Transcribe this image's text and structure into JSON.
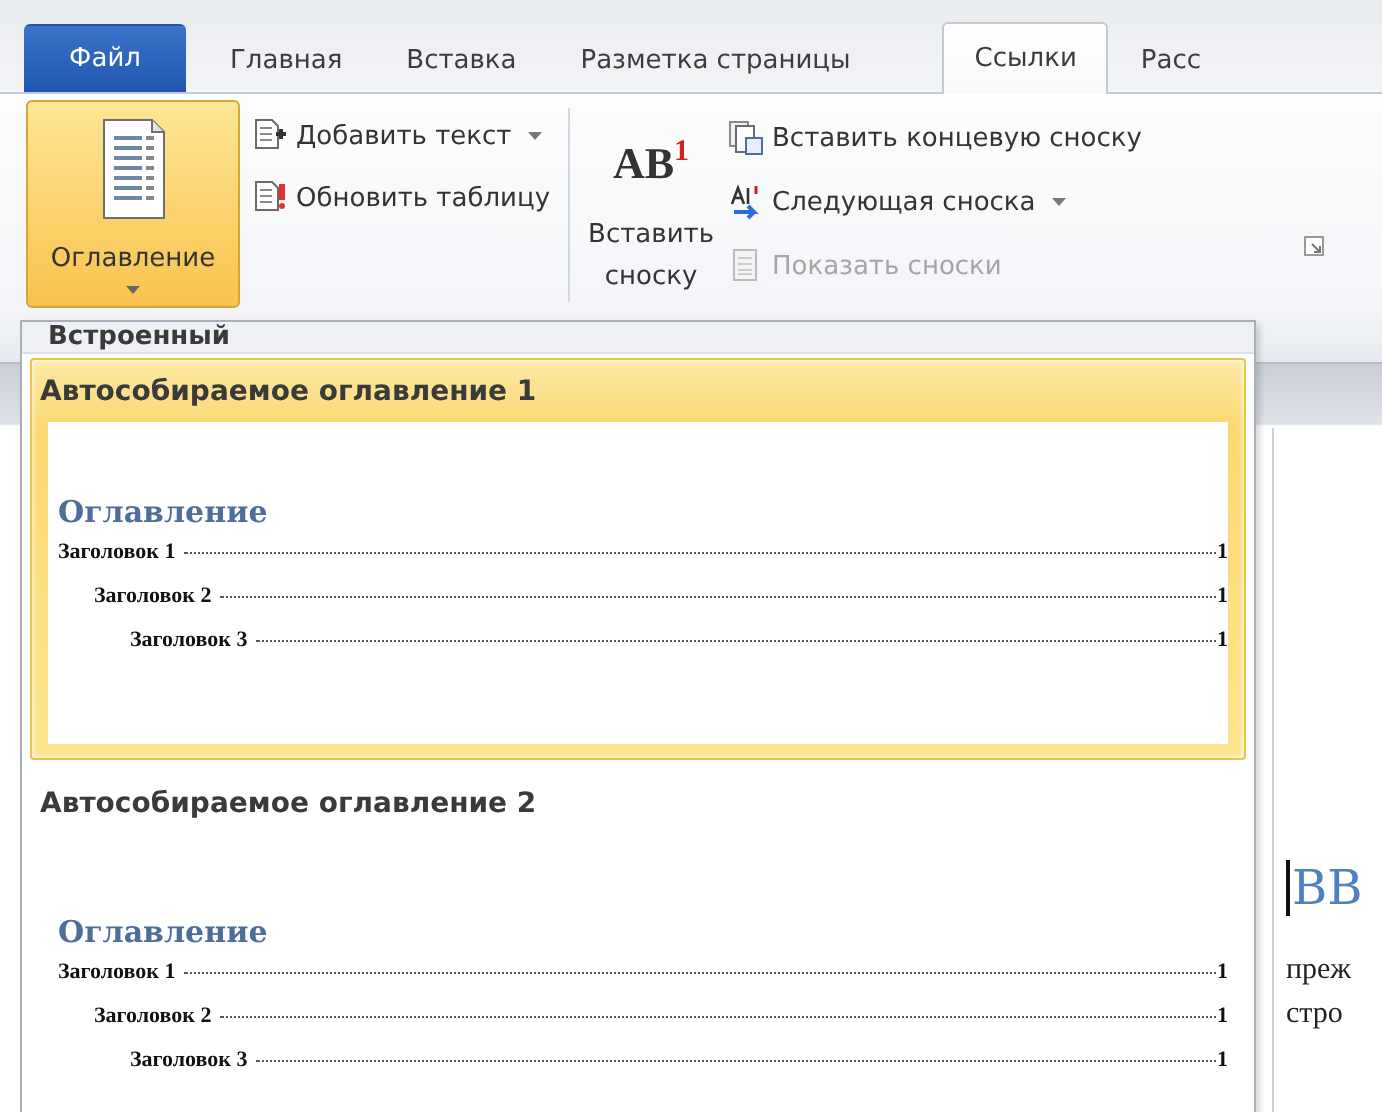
{
  "tabs": [
    {
      "label": "Файл",
      "kind": "file",
      "selected": false
    },
    {
      "label": "Главная",
      "kind": "tab",
      "selected": false
    },
    {
      "label": "Вставка",
      "kind": "tab",
      "selected": false
    },
    {
      "label": "Разметка страницы",
      "kind": "tab",
      "selected": false
    },
    {
      "label": "Ссылки",
      "kind": "tab",
      "selected": true
    },
    {
      "label": "Расс",
      "kind": "tab",
      "selected": false
    }
  ],
  "ribbon": {
    "toc_button": {
      "label": "Оглавление",
      "pressed": true
    },
    "toc_commands": [
      {
        "label": "Добавить текст",
        "kind": "add-text",
        "dropdown": true,
        "disabled": false
      },
      {
        "label": "Обновить таблицу",
        "kind": "update",
        "dropdown": false,
        "disabled": false
      }
    ],
    "footnote_button": {
      "icon_text": "AB$^{1}$",
      "label_lines": [
        "Вставить",
        "сноску"
      ]
    },
    "footnote_commands": [
      {
        "label": "Вставить концевую сноску",
        "kind": "endnote",
        "dropdown": false,
        "disabled": false
      },
      {
        "label": "Следующая сноска",
        "kind": "next",
        "dropdown": true,
        "disabled": false
      },
      {
        "label": "Показать сноски",
        "kind": "show",
        "dropdown": false,
        "disabled": true
      }
    ]
  },
  "menu": {
    "header": "Встроенный",
    "items": [
      {
        "title": "Автособираемое оглавление 1",
        "selected": true,
        "preview": {
          "heading": "Оглавление",
          "entries": [
            {
              "text": "Заголовок 1",
              "page": "1",
              "children": [
                {
                  "text": "Заголовок 2",
                  "page": "1",
                  "children": [
                    {
                      "text": "Заголовок 3",
                      "page": "1"
                    }
                  ]
                }
              ]
            }
          ]
        }
      },
      {
        "title": "Автособираемое оглавление 2",
        "selected": false,
        "preview": {
          "heading": "Оглавление",
          "entries": [
            {
              "text": "Заголовок 1",
              "page": "1",
              "children": [
                {
                  "text": "Заголовок 2",
                  "page": "1",
                  "children": [
                    {
                      "text": "Заголовок 3",
                      "page": "1"
                    }
                  ]
                }
              ]
            }
          ]
        }
      }
    ]
  },
  "document": {
    "heading": "ВВ",
    "lines": [
      "преж",
      "стро"
    ]
  }
}
